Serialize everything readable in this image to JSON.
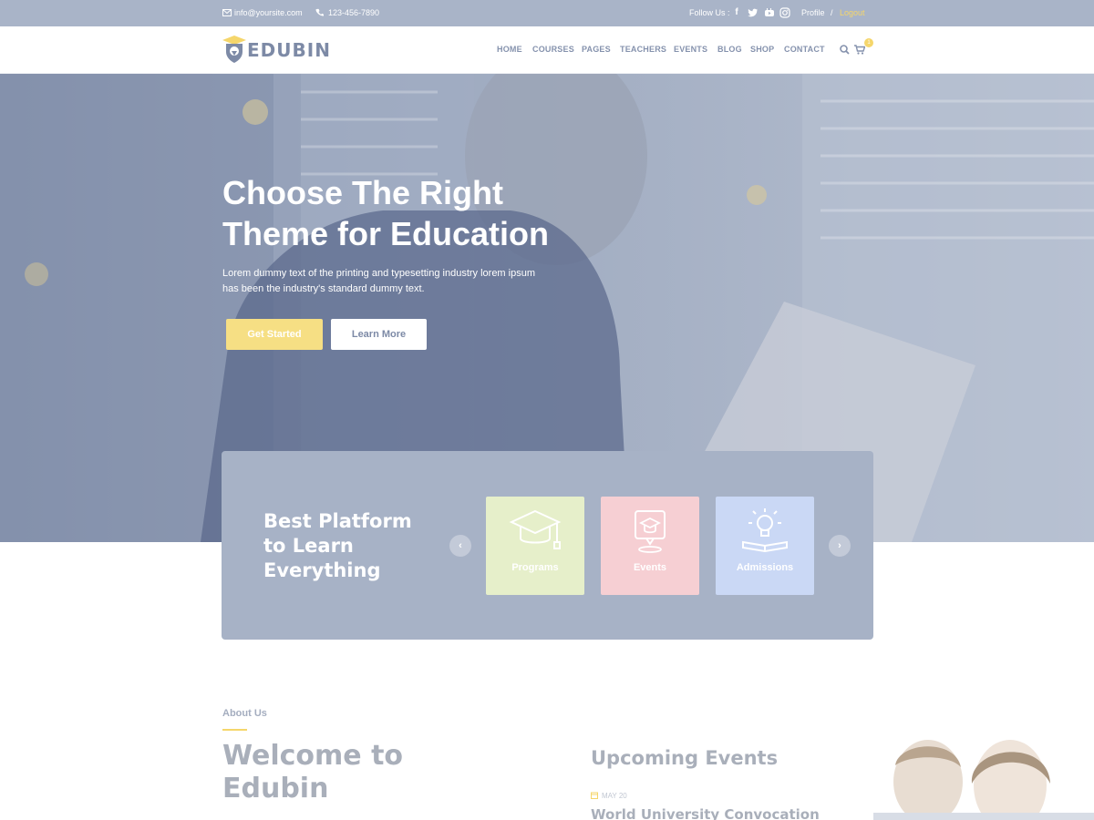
{
  "topbar": {
    "email": "info@yoursite.com",
    "phone": "123-456-7890",
    "follow_label": "Follow Us :",
    "social_icons": [
      "facebook-icon",
      "twitter-icon",
      "youtube-icon",
      "instagram-icon"
    ],
    "profile_link": "Profile",
    "separator": "/",
    "logout_link": "Logout"
  },
  "header": {
    "logo_text": "EDUBIN",
    "nav": [
      "HOME",
      "COURSES",
      "PAGES",
      "TEACHERS",
      "EVENTS",
      "BLOG",
      "SHOP",
      "CONTACT"
    ],
    "cart_count": "1"
  },
  "hero": {
    "title_line1": "Choose The Right",
    "title_line2": "Theme for Education",
    "subtitle_line1": "Lorem dummy text of the printing and typesetting industry lorem ipsum",
    "subtitle_line2": "has been the industry's standard dummy text.",
    "primary_button": "Get Started",
    "secondary_button": "Learn More"
  },
  "platform": {
    "title_line1": "Best Platform",
    "title_line2": "to Learn",
    "title_line3": "Everything",
    "prev_arrow": "‹",
    "next_arrow": "›",
    "cards": [
      {
        "label": "Programs",
        "icon": "graduation-cap-icon",
        "color": "#e6efca"
      },
      {
        "label": "Events",
        "icon": "event-pin-icon",
        "color": "#f6cfd3"
      },
      {
        "label": "Admissions",
        "icon": "lightbulb-book-icon",
        "color": "#cad8f5"
      }
    ]
  },
  "about": {
    "label": "About Us",
    "title_line1": "Welcome to",
    "title_line2": "Edubin"
  },
  "events": {
    "heading": "Upcoming Events",
    "date": "MAY 20",
    "title": "World University Convocation"
  },
  "colors": {
    "topbar_bg": "#a9b4c8",
    "accent_yellow": "#f5d66b",
    "panel_bg": "#a7b2c6",
    "nav_text": "#8592ad"
  }
}
